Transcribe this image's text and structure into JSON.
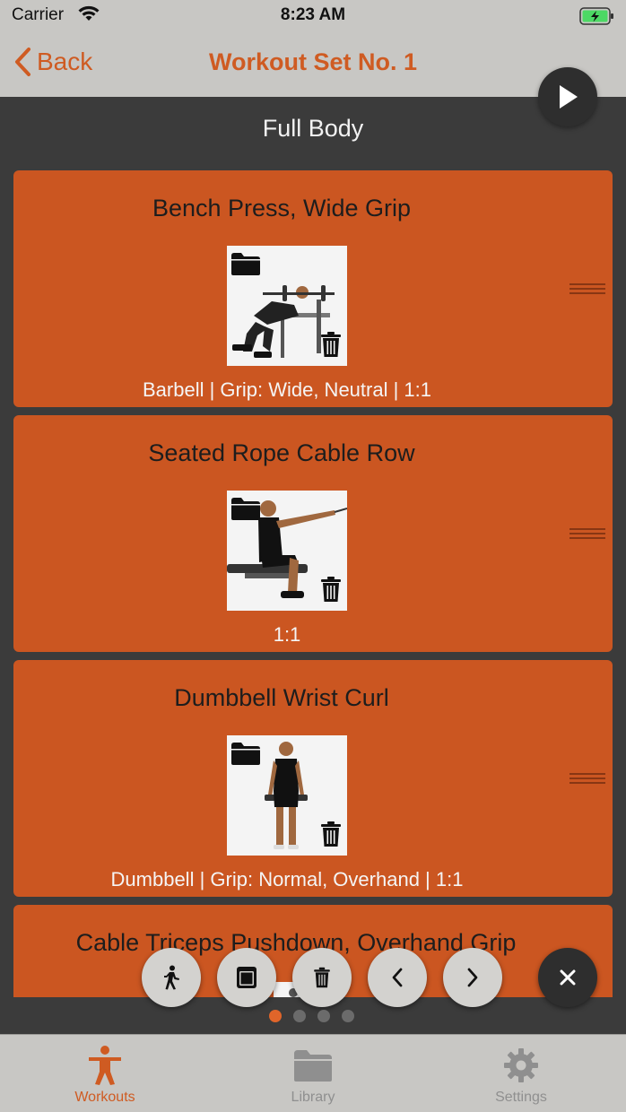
{
  "status_bar": {
    "carrier": "Carrier",
    "time": "8:23 AM"
  },
  "nav": {
    "back_label": "Back",
    "title": "Workout Set No. 1"
  },
  "section_title": "Full Body",
  "exercises": [
    {
      "title": "Bench Press, Wide Grip",
      "detail": "Barbell | Grip: Wide, Neutral | 1:1"
    },
    {
      "title": "Seated Rope Cable Row",
      "detail": "1:1"
    },
    {
      "title": "Dumbbell Wrist Curl",
      "detail": "Dumbbell | Grip: Normal, Overhand | 1:1"
    },
    {
      "title": "Cable Triceps Pushdown, Overhand Grip",
      "detail": ""
    }
  ],
  "toolbar": {
    "icons": [
      "walking-icon",
      "stop-icon",
      "trash-icon",
      "chevron-left-icon",
      "chevron-right-icon",
      "close-icon"
    ]
  },
  "pagination": {
    "count": 4,
    "active": 1
  },
  "tabs": [
    {
      "label": "Workouts",
      "icon": "person-icon",
      "active": true
    },
    {
      "label": "Library",
      "icon": "folder-icon",
      "active": false
    },
    {
      "label": "Settings",
      "icon": "gear-icon",
      "active": false
    }
  ],
  "colors": {
    "accent": "#cf5b22",
    "card": "#cb5621",
    "background": "#3b3b3b",
    "bars": "#c8c7c4"
  }
}
